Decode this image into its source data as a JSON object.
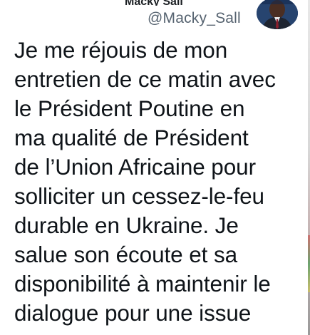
{
  "tweet": {
    "top_partial_text": "Macky Sall",
    "handle": "@Macky_Sall",
    "avatar_icon": "profile-photo",
    "body": "Je me réjouis de mon\nentretien de ce matin avec\nle Président Poutine en\nma qualité de Président\nde l’Union Africaine pour\nsolliciter un cessez-le-feu\ndurable en Ukraine. Je\nsalue son écoute et sa\ndisponibilité à maintenir le\ndialogue pour une issue"
  },
  "colors": {
    "text": "#0f1419",
    "handle": "#566370",
    "background": "#ffffff"
  }
}
